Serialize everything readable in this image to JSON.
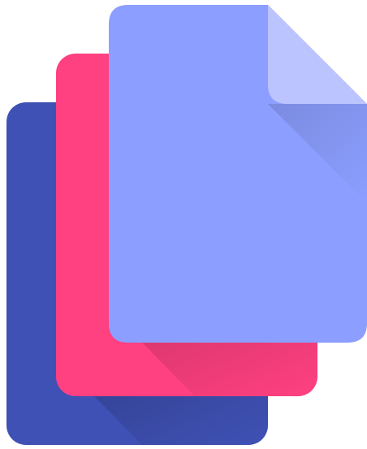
{
  "icon": {
    "name": "stacked-documents-icon",
    "colors": {
      "back_page": "#3F51B5",
      "middle_page": "#FF4081",
      "front_page": "#8C9EFF",
      "front_page_fold": "#BBC4FF",
      "shadow": "#000000"
    }
  }
}
